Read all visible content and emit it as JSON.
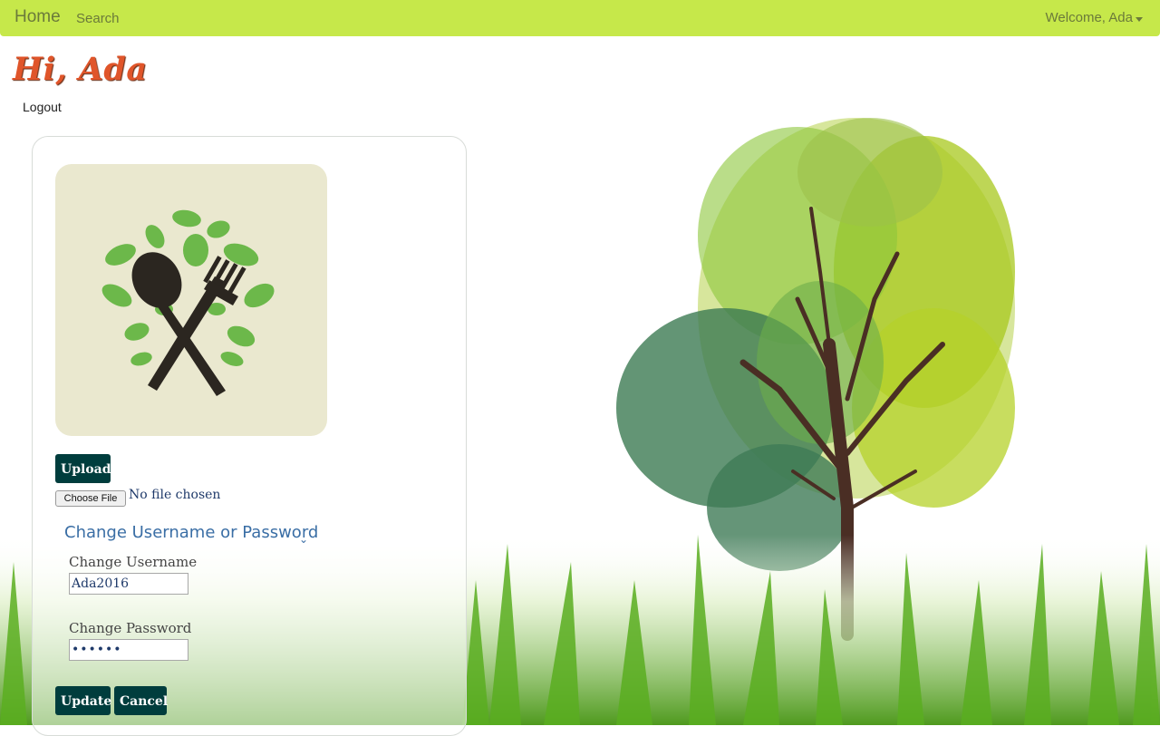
{
  "nav": {
    "home": "Home",
    "search": "Search",
    "welcome": "Welcome, Ada"
  },
  "greeting": "Hi, Ada",
  "logout": "Logout",
  "profile": {
    "upload_label": "Upload",
    "choose_file_label": "Choose File",
    "file_status": "No file chosen",
    "section_title": "Change Username or Password",
    "username_label": "Change Username",
    "username_value": "Ada2016",
    "password_label": "Change Password",
    "password_value": "••••••",
    "update_label": "Update",
    "cancel_label": "Cancel"
  },
  "colors": {
    "navbar": "#c6e84a",
    "greeting": "#e0552a",
    "button": "#003d3d",
    "link": "#3a6ea5"
  },
  "icons": {
    "avatar": "spoon-fork-leaves-icon",
    "dropdown": "caret-down-icon",
    "section_toggle": "chevron-down-icon"
  }
}
